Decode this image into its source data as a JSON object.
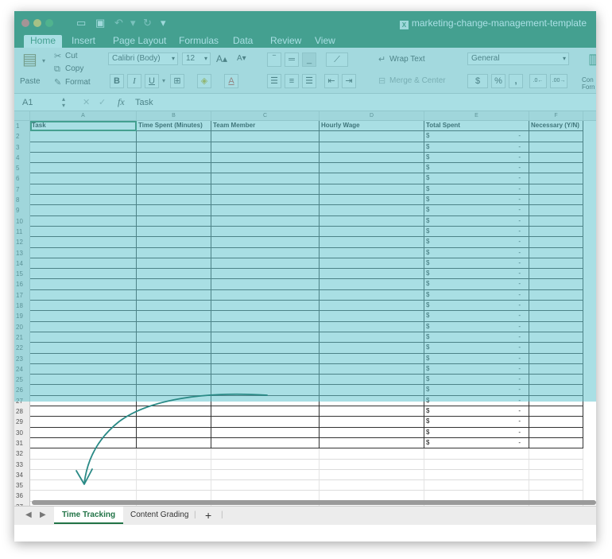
{
  "window": {
    "title": "marketing-change-management-template"
  },
  "ribbon_tabs": [
    "Home",
    "Insert",
    "Page Layout",
    "Formulas",
    "Data",
    "Review",
    "View"
  ],
  "ribbon": {
    "paste": "Paste",
    "cut": "Cut",
    "copy": "Copy",
    "format": "Format",
    "font_name": "Calibri (Body)",
    "font_size": "12",
    "bold": "B",
    "italic": "I",
    "underline": "U",
    "wrap_text": "Wrap Text",
    "merge_center": "Merge & Center",
    "number_format": "General",
    "currency": "$",
    "percent": "%",
    "comma": ",",
    "cond_format": "Con Forn"
  },
  "formula_bar": {
    "cell_ref": "A1",
    "fx": "fx",
    "content": "Task"
  },
  "columns": [
    "A",
    "B",
    "C",
    "D",
    "E",
    "F"
  ],
  "headers": [
    "Task",
    "Time Spent (Minutes)",
    "Team Member",
    "Hourly Wage",
    "Total Spent",
    "Necessary (Y/N)"
  ],
  "currency_symbol": "$",
  "empty_value": "-",
  "data_row_count": 30,
  "total_rows": 37,
  "sheets": [
    {
      "label": "Time Tracking",
      "active": true
    },
    {
      "label": "Content Grading",
      "active": false
    }
  ],
  "add_sheet": "+",
  "colors": {
    "excel_green": "#217346",
    "overlay_teal": "#62c4ce",
    "annotation": "#2a8a86"
  }
}
